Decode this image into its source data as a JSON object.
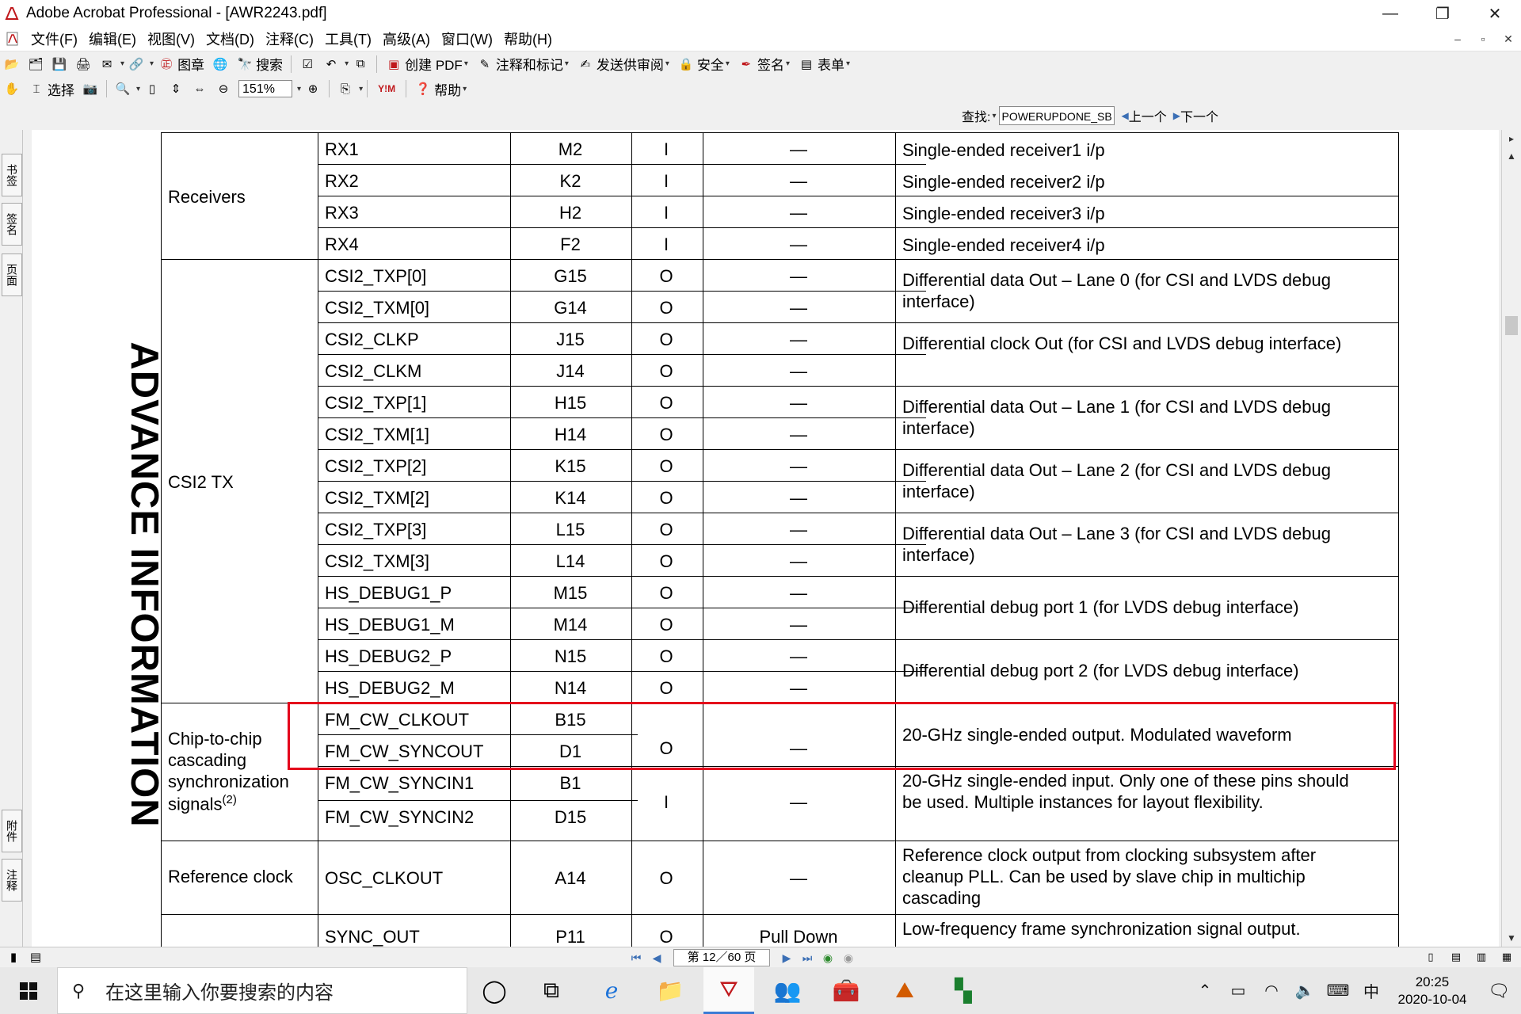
{
  "window": {
    "title": "Adobe Acrobat Professional - [AWR2243.pdf]",
    "minimize": "—",
    "restore": "❐",
    "close": "✕"
  },
  "menu": {
    "items": [
      "文件(F)",
      "编辑(E)",
      "视图(V)",
      "文档(D)",
      "注释(C)",
      "工具(T)",
      "高级(A)",
      "窗口(W)",
      "帮助(H)"
    ],
    "doc_controls": [
      "–",
      "▫",
      "✕"
    ]
  },
  "toolbar1": {
    "stamp": "图章",
    "search": "搜索",
    "create_pdf": "创建 PDF",
    "comment_markup": "注释和标记",
    "send_review": "发送供审阅",
    "security": "安全",
    "sign": "签名",
    "forms": "表单"
  },
  "toolbar2": {
    "select": "选择",
    "zoom": "151%",
    "help": "帮助"
  },
  "find": {
    "label": "查找:",
    "query": "POWERUPDONE_SB",
    "prev": "上一个",
    "next": "下一个"
  },
  "left_tabs": [
    "书签",
    "签名",
    "页面",
    "附件",
    "注释"
  ],
  "page": {
    "side_heading": "ADVANCE INFORMATION",
    "groups": [
      "Receivers",
      "CSI2 TX",
      "Chip-to-chip",
      "cascading",
      "synchronization",
      "signals",
      "(2)",
      "Reference clock"
    ],
    "rows": [
      {
        "name": "RX1",
        "ball": "M2",
        "type": "I",
        "pull": "—"
      },
      {
        "name": "RX2",
        "ball": "K2",
        "type": "I",
        "pull": "—"
      },
      {
        "name": "RX3",
        "ball": "H2",
        "type": "I",
        "pull": "—"
      },
      {
        "name": "RX4",
        "ball": "F2",
        "type": "I",
        "pull": "—"
      },
      {
        "name": "CSI2_TXP[0]",
        "ball": "G15",
        "type": "O",
        "pull": "—"
      },
      {
        "name": "CSI2_TXM[0]",
        "ball": "G14",
        "type": "O",
        "pull": "—"
      },
      {
        "name": "CSI2_CLKP",
        "ball": "J15",
        "type": "O",
        "pull": "—"
      },
      {
        "name": "CSI2_CLKM",
        "ball": "J14",
        "type": "O",
        "pull": "—"
      },
      {
        "name": "CSI2_TXP[1]",
        "ball": "H15",
        "type": "O",
        "pull": "—"
      },
      {
        "name": "CSI2_TXM[1]",
        "ball": "H14",
        "type": "O",
        "pull": "—"
      },
      {
        "name": "CSI2_TXP[2]",
        "ball": "K15",
        "type": "O",
        "pull": "—"
      },
      {
        "name": "CSI2_TXM[2]",
        "ball": "K14",
        "type": "O",
        "pull": "—"
      },
      {
        "name": "CSI2_TXP[3]",
        "ball": "L15",
        "type": "O",
        "pull": "—"
      },
      {
        "name": "CSI2_TXM[3]",
        "ball": "L14",
        "type": "O",
        "pull": "—"
      },
      {
        "name": "HS_DEBUG1_P",
        "ball": "M15",
        "type": "O",
        "pull": "—"
      },
      {
        "name": "HS_DEBUG1_M",
        "ball": "M14",
        "type": "O",
        "pull": "—"
      },
      {
        "name": "HS_DEBUG2_P",
        "ball": "N15",
        "type": "O",
        "pull": "—"
      },
      {
        "name": "HS_DEBUG2_M",
        "ball": "N14",
        "type": "O",
        "pull": "—"
      },
      {
        "name": "FM_CW_CLKOUT",
        "ball": "B15",
        "type": "",
        "pull": ""
      },
      {
        "name": "FM_CW_SYNCOUT",
        "ball": "D1",
        "type": "",
        "pull": ""
      },
      {
        "name": "FM_CW_SYNCIN1",
        "ball": "B1",
        "type": "",
        "pull": ""
      },
      {
        "name": "FM_CW_SYNCIN2",
        "ball": "D15",
        "type": "",
        "pull": ""
      },
      {
        "name": "OSC_CLKOUT",
        "ball": "A14",
        "type": "O",
        "pull": "—"
      },
      {
        "name": "SYNC_OUT",
        "ball": "P11",
        "type": "O",
        "pull": "Pull Down"
      }
    ],
    "merged": [
      {
        "type": "O",
        "pull": "—"
      },
      {
        "type": "I",
        "pull": "—"
      }
    ],
    "descriptions": [
      "Single-ended receiver1 i/p",
      "Single-ended receiver2 i/p",
      "Single-ended receiver3 i/p",
      "Single-ended receiver4 i/p",
      "Differential data Out – Lane 0 (for CSI and LVDS debug interface)",
      "Differential clock Out (for CSI and LVDS debug interface)",
      "Differential data Out – Lane 1 (for CSI and LVDS debug interface)",
      "Differential data Out – Lane 2 (for CSI and LVDS debug interface)",
      "Differential data Out – Lane 3 (for CSI and LVDS debug interface)",
      "Differential debug port 1 (for LVDS debug interface)",
      "Differential debug port 2 (for LVDS debug interface)",
      "20-GHz single-ended output. Modulated waveform",
      "20-GHz single-ended input. Only one of these pins should be used. Multiple instances for layout flexibility.",
      "Reference clock output from clocking subsystem after cleanup PLL. Can be used by slave chip in multichip cascading",
      "Low-frequency frame synchronization signal output."
    ]
  },
  "status": {
    "page_indicator": "第 12／60 页"
  },
  "taskbar": {
    "search_placeholder": "在这里输入你要搜索的内容",
    "ime": "中",
    "time": "20:25",
    "date": "2020-10-04"
  },
  "colors": {
    "highlight_box": "#e4001b",
    "toolbar_bg": "#f0f0f0",
    "taskbar_bg": "#e8e8e8",
    "accent": "#3a7bd5"
  }
}
